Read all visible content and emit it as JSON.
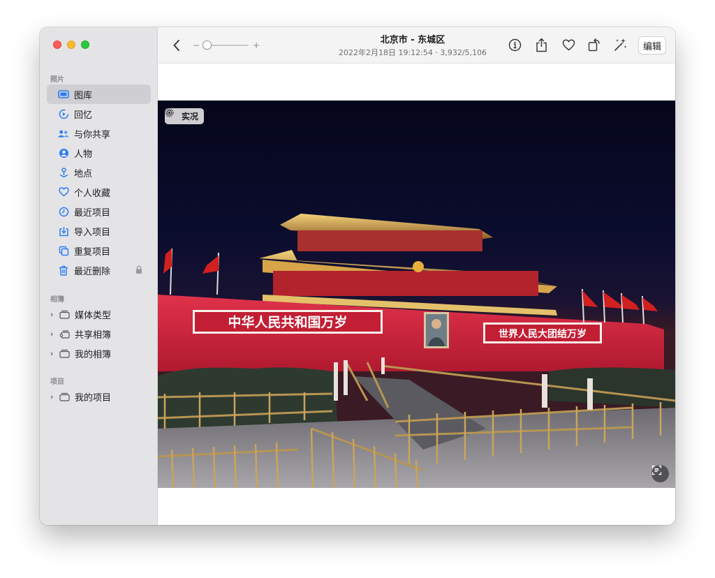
{
  "window": {
    "title": "北京市 - 东城区",
    "subtitle": "2022年2月18日 19:12:54 · 3,932/5,106"
  },
  "toolbar": {
    "zoom_minus": "−",
    "zoom_plus": "+",
    "zoom_level": 0,
    "edit_label": "编辑"
  },
  "sidebar": {
    "sections": {
      "photos": "照片",
      "albums": "相簿",
      "projects": "项目"
    },
    "items": [
      {
        "label": "图库",
        "icon": "library-icon",
        "selected": true
      },
      {
        "label": "回忆",
        "icon": "memories-icon"
      },
      {
        "label": "与你共享",
        "icon": "shared-with-you-icon"
      },
      {
        "label": "人物",
        "icon": "people-icon"
      },
      {
        "label": "地点",
        "icon": "places-icon"
      },
      {
        "label": "个人收藏",
        "icon": "heart-icon"
      },
      {
        "label": "最近项目",
        "icon": "clock-icon"
      },
      {
        "label": "导入项目",
        "icon": "import-icon"
      },
      {
        "label": "重复项目",
        "icon": "duplicates-icon"
      },
      {
        "label": "最近删除",
        "icon": "trash-icon",
        "locked": true
      }
    ],
    "albums": [
      {
        "label": "媒体类型",
        "icon": "folder-icon"
      },
      {
        "label": "共享相簿",
        "icon": "shared-folder-icon"
      },
      {
        "label": "我的相簿",
        "icon": "folder-icon"
      }
    ],
    "projects": [
      {
        "label": "我的项目",
        "icon": "folder-icon"
      }
    ]
  },
  "photo": {
    "live_label": "实况",
    "banner_left": "中华人民共和国万岁",
    "banner_right": "世界人民大团结万岁"
  },
  "colors": {
    "accent": "#2b7cf6",
    "sidebar_bg": "#e4e4e6",
    "wall_red": "#c8203a"
  }
}
